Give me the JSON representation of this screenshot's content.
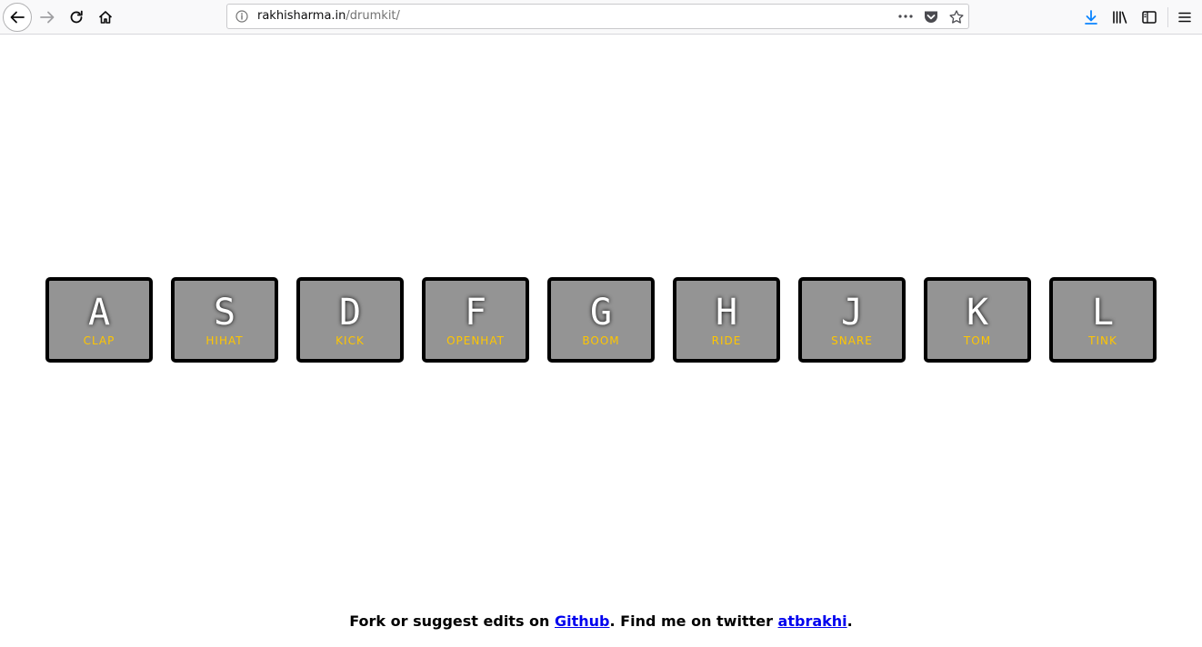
{
  "browser": {
    "url_domain": "rakhisharma.in",
    "url_path": "/drumkit/",
    "icons": [
      "back-arrow-icon",
      "forward-arrow-icon",
      "reload-icon",
      "home-icon",
      "info-icon",
      "more-dots-icon",
      "pocket-icon",
      "star-icon",
      "download-icon",
      "library-icon",
      "sidebar-icon",
      "menu-icon"
    ],
    "colors": {
      "download_accent": "#0a84ff"
    }
  },
  "keys": [
    {
      "letter": "A",
      "sound": "clap"
    },
    {
      "letter": "S",
      "sound": "hihat"
    },
    {
      "letter": "D",
      "sound": "kick"
    },
    {
      "letter": "F",
      "sound": "openhat"
    },
    {
      "letter": "G",
      "sound": "boom"
    },
    {
      "letter": "H",
      "sound": "ride"
    },
    {
      "letter": "J",
      "sound": "snare"
    },
    {
      "letter": "K",
      "sound": "tom"
    },
    {
      "letter": "L",
      "sound": "tink"
    }
  ],
  "footer": {
    "text_before": "Fork or suggest edits on ",
    "github_link": "Github",
    "text_middle": ". Find me on twitter ",
    "twitter_link": "atbrakhi",
    "text_after": "."
  },
  "colors": {
    "key_background": "#949494",
    "key_border": "#000000",
    "letter_color": "#ffffff",
    "sound_color": "#ffc600",
    "link_color": "#0000ee"
  }
}
